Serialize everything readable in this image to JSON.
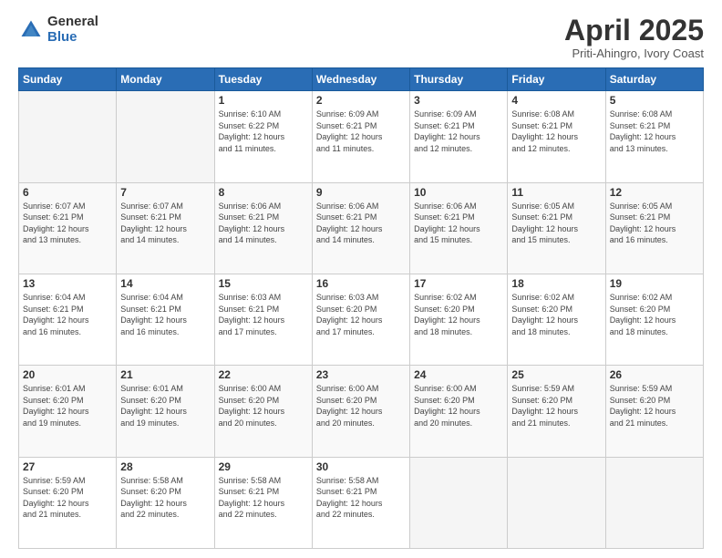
{
  "logo": {
    "general": "General",
    "blue": "Blue"
  },
  "header": {
    "title": "April 2025",
    "subtitle": "Priti-Ahingro, Ivory Coast"
  },
  "weekdays": [
    "Sunday",
    "Monday",
    "Tuesday",
    "Wednesday",
    "Thursday",
    "Friday",
    "Saturday"
  ],
  "weeks": [
    [
      {
        "day": "",
        "info": ""
      },
      {
        "day": "",
        "info": ""
      },
      {
        "day": "1",
        "info": "Sunrise: 6:10 AM\nSunset: 6:22 PM\nDaylight: 12 hours\nand 11 minutes."
      },
      {
        "day": "2",
        "info": "Sunrise: 6:09 AM\nSunset: 6:21 PM\nDaylight: 12 hours\nand 11 minutes."
      },
      {
        "day": "3",
        "info": "Sunrise: 6:09 AM\nSunset: 6:21 PM\nDaylight: 12 hours\nand 12 minutes."
      },
      {
        "day": "4",
        "info": "Sunrise: 6:08 AM\nSunset: 6:21 PM\nDaylight: 12 hours\nand 12 minutes."
      },
      {
        "day": "5",
        "info": "Sunrise: 6:08 AM\nSunset: 6:21 PM\nDaylight: 12 hours\nand 13 minutes."
      }
    ],
    [
      {
        "day": "6",
        "info": "Sunrise: 6:07 AM\nSunset: 6:21 PM\nDaylight: 12 hours\nand 13 minutes."
      },
      {
        "day": "7",
        "info": "Sunrise: 6:07 AM\nSunset: 6:21 PM\nDaylight: 12 hours\nand 14 minutes."
      },
      {
        "day": "8",
        "info": "Sunrise: 6:06 AM\nSunset: 6:21 PM\nDaylight: 12 hours\nand 14 minutes."
      },
      {
        "day": "9",
        "info": "Sunrise: 6:06 AM\nSunset: 6:21 PM\nDaylight: 12 hours\nand 14 minutes."
      },
      {
        "day": "10",
        "info": "Sunrise: 6:06 AM\nSunset: 6:21 PM\nDaylight: 12 hours\nand 15 minutes."
      },
      {
        "day": "11",
        "info": "Sunrise: 6:05 AM\nSunset: 6:21 PM\nDaylight: 12 hours\nand 15 minutes."
      },
      {
        "day": "12",
        "info": "Sunrise: 6:05 AM\nSunset: 6:21 PM\nDaylight: 12 hours\nand 16 minutes."
      }
    ],
    [
      {
        "day": "13",
        "info": "Sunrise: 6:04 AM\nSunset: 6:21 PM\nDaylight: 12 hours\nand 16 minutes."
      },
      {
        "day": "14",
        "info": "Sunrise: 6:04 AM\nSunset: 6:21 PM\nDaylight: 12 hours\nand 16 minutes."
      },
      {
        "day": "15",
        "info": "Sunrise: 6:03 AM\nSunset: 6:21 PM\nDaylight: 12 hours\nand 17 minutes."
      },
      {
        "day": "16",
        "info": "Sunrise: 6:03 AM\nSunset: 6:20 PM\nDaylight: 12 hours\nand 17 minutes."
      },
      {
        "day": "17",
        "info": "Sunrise: 6:02 AM\nSunset: 6:20 PM\nDaylight: 12 hours\nand 18 minutes."
      },
      {
        "day": "18",
        "info": "Sunrise: 6:02 AM\nSunset: 6:20 PM\nDaylight: 12 hours\nand 18 minutes."
      },
      {
        "day": "19",
        "info": "Sunrise: 6:02 AM\nSunset: 6:20 PM\nDaylight: 12 hours\nand 18 minutes."
      }
    ],
    [
      {
        "day": "20",
        "info": "Sunrise: 6:01 AM\nSunset: 6:20 PM\nDaylight: 12 hours\nand 19 minutes."
      },
      {
        "day": "21",
        "info": "Sunrise: 6:01 AM\nSunset: 6:20 PM\nDaylight: 12 hours\nand 19 minutes."
      },
      {
        "day": "22",
        "info": "Sunrise: 6:00 AM\nSunset: 6:20 PM\nDaylight: 12 hours\nand 20 minutes."
      },
      {
        "day": "23",
        "info": "Sunrise: 6:00 AM\nSunset: 6:20 PM\nDaylight: 12 hours\nand 20 minutes."
      },
      {
        "day": "24",
        "info": "Sunrise: 6:00 AM\nSunset: 6:20 PM\nDaylight: 12 hours\nand 20 minutes."
      },
      {
        "day": "25",
        "info": "Sunrise: 5:59 AM\nSunset: 6:20 PM\nDaylight: 12 hours\nand 21 minutes."
      },
      {
        "day": "26",
        "info": "Sunrise: 5:59 AM\nSunset: 6:20 PM\nDaylight: 12 hours\nand 21 minutes."
      }
    ],
    [
      {
        "day": "27",
        "info": "Sunrise: 5:59 AM\nSunset: 6:20 PM\nDaylight: 12 hours\nand 21 minutes."
      },
      {
        "day": "28",
        "info": "Sunrise: 5:58 AM\nSunset: 6:20 PM\nDaylight: 12 hours\nand 22 minutes."
      },
      {
        "day": "29",
        "info": "Sunrise: 5:58 AM\nSunset: 6:21 PM\nDaylight: 12 hours\nand 22 minutes."
      },
      {
        "day": "30",
        "info": "Sunrise: 5:58 AM\nSunset: 6:21 PM\nDaylight: 12 hours\nand 22 minutes."
      },
      {
        "day": "",
        "info": ""
      },
      {
        "day": "",
        "info": ""
      },
      {
        "day": "",
        "info": ""
      }
    ]
  ]
}
